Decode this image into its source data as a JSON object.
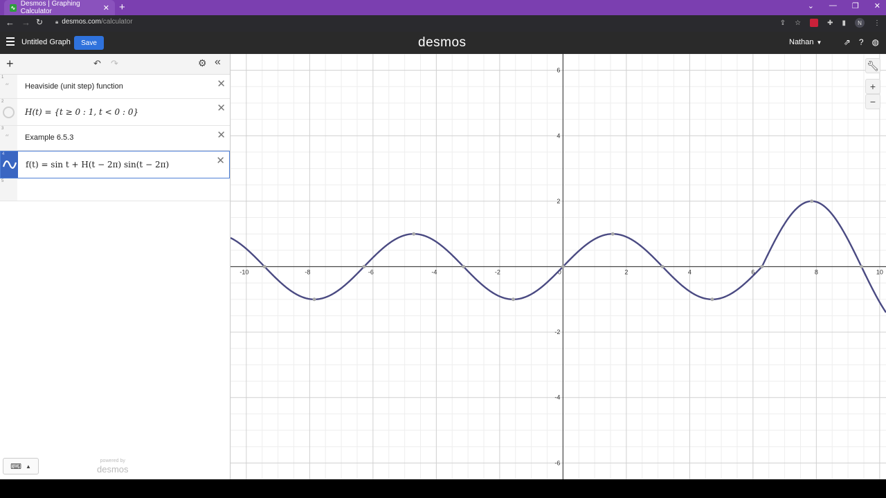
{
  "browser": {
    "tab_title": "Desmos | Graphing Calculator",
    "tab_close": "✕",
    "new_tab": "+",
    "url_host": "desmos.com",
    "url_path": "/calculator",
    "profile_initial": "N",
    "window_controls": [
      "⌄",
      "—",
      "❐",
      "✕"
    ]
  },
  "header": {
    "graph_title": "Untitled Graph",
    "save_label": "Save",
    "logo": "desmos",
    "user_name": "Nathan"
  },
  "expressions": [
    {
      "index": "1",
      "type": "note",
      "text": "Heaviside (unit step) function"
    },
    {
      "index": "2",
      "type": "math",
      "text": "H(t) = {t ≥ 0 : 1, t < 0 : 0}"
    },
    {
      "index": "3",
      "type": "note",
      "text": "Example 6.5.3"
    },
    {
      "index": "4",
      "type": "math",
      "text": "f(t) = sin t + H(t − 2π) sin(t − 2π)",
      "color": "#3a3a7a"
    },
    {
      "index": "5",
      "type": "empty",
      "text": ""
    }
  ],
  "panel": {
    "powered_by": "powered by",
    "powered_logo": "desmos"
  },
  "graph": {
    "x_range": [
      -10.5,
      10.2
    ],
    "y_range": [
      -6.5,
      6.5
    ],
    "x_ticks": [
      "-10",
      "-8",
      "-6",
      "-4",
      "-2",
      "0",
      "2",
      "4",
      "6",
      "8",
      "10"
    ],
    "y_ticks": [
      "6",
      "4",
      "2",
      "-2",
      "-4",
      "-6"
    ],
    "curve_color": "#4a4a82",
    "axis_color": "#444444",
    "grid_major_color": "#d0d0d0",
    "grid_minor_color": "#eeeeee"
  }
}
